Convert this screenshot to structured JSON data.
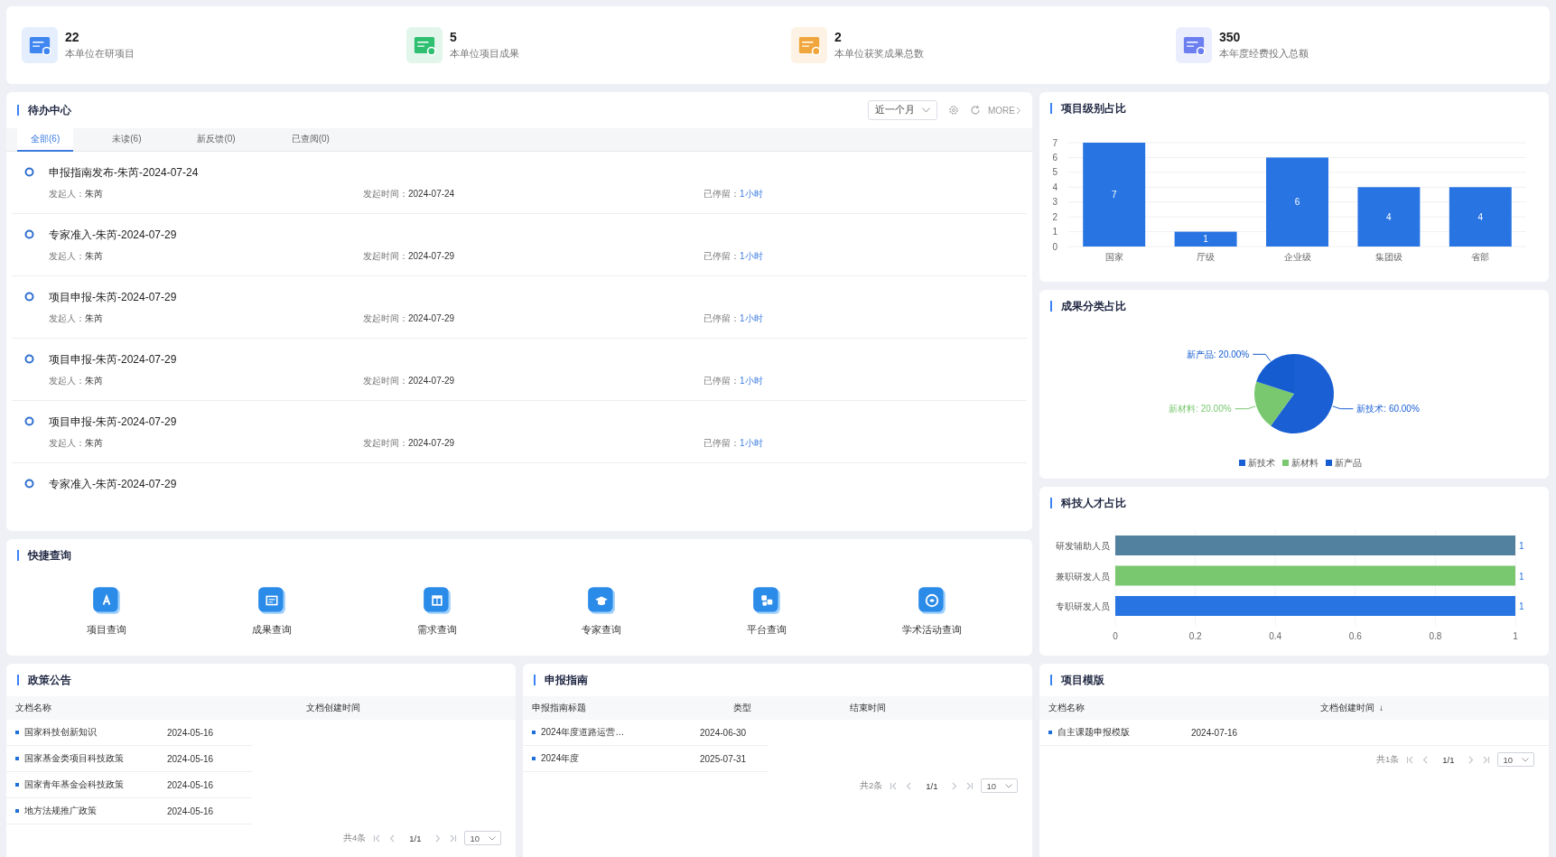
{
  "stats": [
    {
      "value": "22",
      "label": "本单位在研项目",
      "color": "#3f86f0"
    },
    {
      "value": "5",
      "label": "本单位项目成果",
      "color": "#2fbf71"
    },
    {
      "value": "2",
      "label": "本单位获奖成果总数",
      "color": "#f0a63c"
    },
    {
      "value": "350",
      "label": "本年度经费投入总额",
      "color": "#6b7ff0"
    }
  ],
  "todo": {
    "title": "待办中心",
    "period": "近一个月",
    "more": "MORE",
    "tabs": [
      {
        "label": "全部(6)",
        "selected": true
      },
      {
        "label": "未读(6)",
        "selected": false
      },
      {
        "label": "新反馈(0)",
        "selected": false
      },
      {
        "label": "已查阅(0)",
        "selected": false
      }
    ],
    "items": [
      {
        "title": "申报指南发布-朱芮-2024-07-24",
        "initiator_label": "发起人：",
        "initiator": "朱芮",
        "time_label": "发起时间：",
        "time": "2024-07-24",
        "stay_label": "已停留：",
        "stay": "1小时"
      },
      {
        "title": "专家准入-朱芮-2024-07-29",
        "initiator_label": "发起人：",
        "initiator": "朱芮",
        "time_label": "发起时间：",
        "time": "2024-07-29",
        "stay_label": "已停留：",
        "stay": "1小时"
      },
      {
        "title": "项目申报-朱芮-2024-07-29",
        "initiator_label": "发起人：",
        "initiator": "朱芮",
        "time_label": "发起时间：",
        "time": "2024-07-29",
        "stay_label": "已停留：",
        "stay": "1小时"
      },
      {
        "title": "项目申报-朱芮-2024-07-29",
        "initiator_label": "发起人：",
        "initiator": "朱芮",
        "time_label": "发起时间：",
        "time": "2024-07-29",
        "stay_label": "已停留：",
        "stay": "1小时"
      },
      {
        "title": "项目申报-朱芮-2024-07-29",
        "initiator_label": "发起人：",
        "initiator": "朱芮",
        "time_label": "发起时间：",
        "time": "2024-07-29",
        "stay_label": "已停留：",
        "stay": "1小时"
      },
      {
        "title": "专家准入-朱芮-2024-07-29"
      }
    ]
  },
  "quick": {
    "title": "快捷查询",
    "items": [
      "项目查询",
      "成果查询",
      "需求查询",
      "专家查询",
      "平台查询",
      "学术活动查询"
    ]
  },
  "project_level": {
    "title": "项目级别占比",
    "chart_data": {
      "type": "bar",
      "categories": [
        "国家",
        "厅级",
        "企业级",
        "集团级",
        "省部"
      ],
      "values": [
        7,
        1,
        6,
        4,
        4
      ],
      "grid": true,
      "ylim": [
        0,
        7
      ],
      "yticks": [
        0,
        1,
        2,
        3,
        4,
        5,
        6,
        7
      ],
      "data_labels": true
    }
  },
  "achievement": {
    "title": "成果分类占比",
    "chart_data": {
      "type": "pie",
      "categories": [
        "新技术",
        "新材料",
        "新产品"
      ],
      "values": [
        60,
        20,
        20
      ],
      "colors": [
        "#1a5fd3",
        "#79c870",
        "#145ccf"
      ],
      "legend": "bottom",
      "value_labels": [
        "新技术: 60.00%",
        "新材料: 20.00%",
        "新产品: 20.00%"
      ]
    }
  },
  "talent": {
    "title": "科技人才占比",
    "chart_data": {
      "type": "bar",
      "orientation": "horizontal",
      "series": [
        {
          "name": "研发辅助人员",
          "color": "#51819f",
          "values": [
            1
          ]
        },
        {
          "name": "兼职研发人员",
          "color": "#79c870",
          "values": [
            1
          ]
        },
        {
          "name": "专职研发人员",
          "color": "#2774e2",
          "values": [
            1
          ]
        }
      ],
      "grid": true,
      "xlim": [
        0,
        1
      ],
      "xticks": [
        0,
        0.2,
        0.4,
        0.6,
        0.8,
        1
      ],
      "data_labels": true
    }
  },
  "policy": {
    "title": "政策公告",
    "columns": [
      {
        "label": "文档名称"
      },
      {
        "label": "文档创建时间"
      }
    ],
    "rows": [
      [
        "国家科技创新知识",
        "2024-05-16"
      ],
      [
        "国家基金类项目科技政策",
        "2024-05-16"
      ],
      [
        "国家青年基金会科技政策",
        "2024-05-16"
      ],
      [
        "地方法规推广政策",
        "2024-05-16"
      ]
    ],
    "pagination": {
      "total": "共4条",
      "page": "1/1",
      "size": "10"
    }
  },
  "guide": {
    "title": "申报指南",
    "columns": [
      {
        "label": "申报指南标题"
      },
      {
        "label": "类型"
      },
      {
        "label": "结束时间"
      }
    ],
    "rows": [
      [
        "2024年度道路运营…",
        "2024-06-30"
      ],
      [
        "2024年度",
        "2025-07-31"
      ]
    ],
    "pagination": {
      "total": "共2条",
      "page": "1/1",
      "size": "10"
    }
  },
  "template": {
    "title": "项目模版",
    "columns": [
      {
        "label": "文档名称"
      },
      {
        "label": "文档创建时间",
        "sort_mark": "↓"
      }
    ],
    "rows": [
      [
        "自主课题申报模版",
        "2024-07-16"
      ]
    ],
    "pagination": {
      "total": "共1条",
      "page": "1/1",
      "size": "10"
    }
  }
}
